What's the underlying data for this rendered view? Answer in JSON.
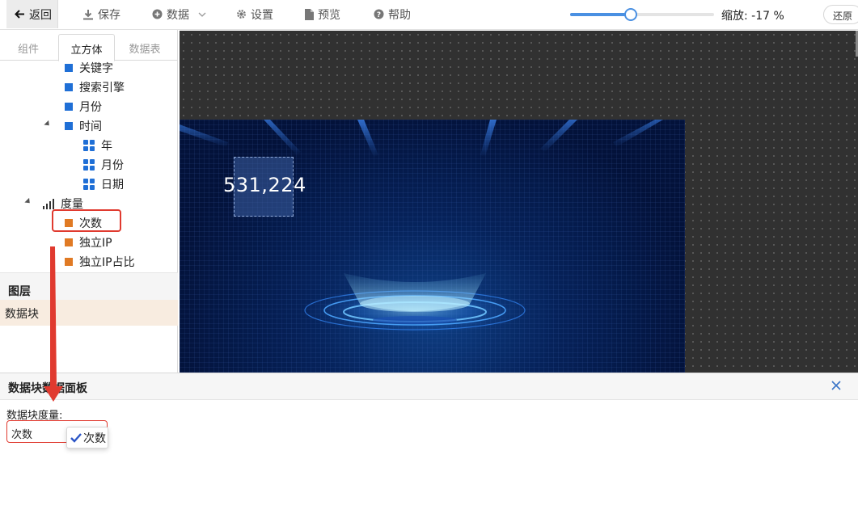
{
  "toolbar": {
    "back_label": "返回",
    "save_label": "保存",
    "data_label": "数据",
    "settings_label": "设置",
    "preview_label": "预览",
    "help_label": "帮助",
    "zoom_label": "缩放: -17 %",
    "zoom_level_percent": 42,
    "restore_label": "还原"
  },
  "left_panel": {
    "tabs": [
      "组件",
      "立方体",
      "数据表"
    ],
    "active_tab": "立方体",
    "dimensions": [
      "关键字",
      "搜索引擎",
      "月份"
    ],
    "time_group": {
      "label": "时间",
      "children": [
        "年",
        "月份",
        "日期"
      ]
    },
    "measure_group": {
      "label": "度量",
      "children": [
        "次数",
        "独立IP",
        "独立IP占比"
      ]
    }
  },
  "layers": {
    "title": "图层",
    "items": [
      "数据块"
    ]
  },
  "canvas": {
    "data_block_value": "531,224"
  },
  "bottom_panel": {
    "title": "数据块数据面板",
    "field_label": "数据块度量:",
    "field_value": "次数",
    "dropdown_option": "次数"
  },
  "colors": {
    "accent": "#4a90e2",
    "dimension_icon": "#1f6fd6",
    "measure_icon": "#e07a24",
    "highlight": "#e03a2f"
  }
}
